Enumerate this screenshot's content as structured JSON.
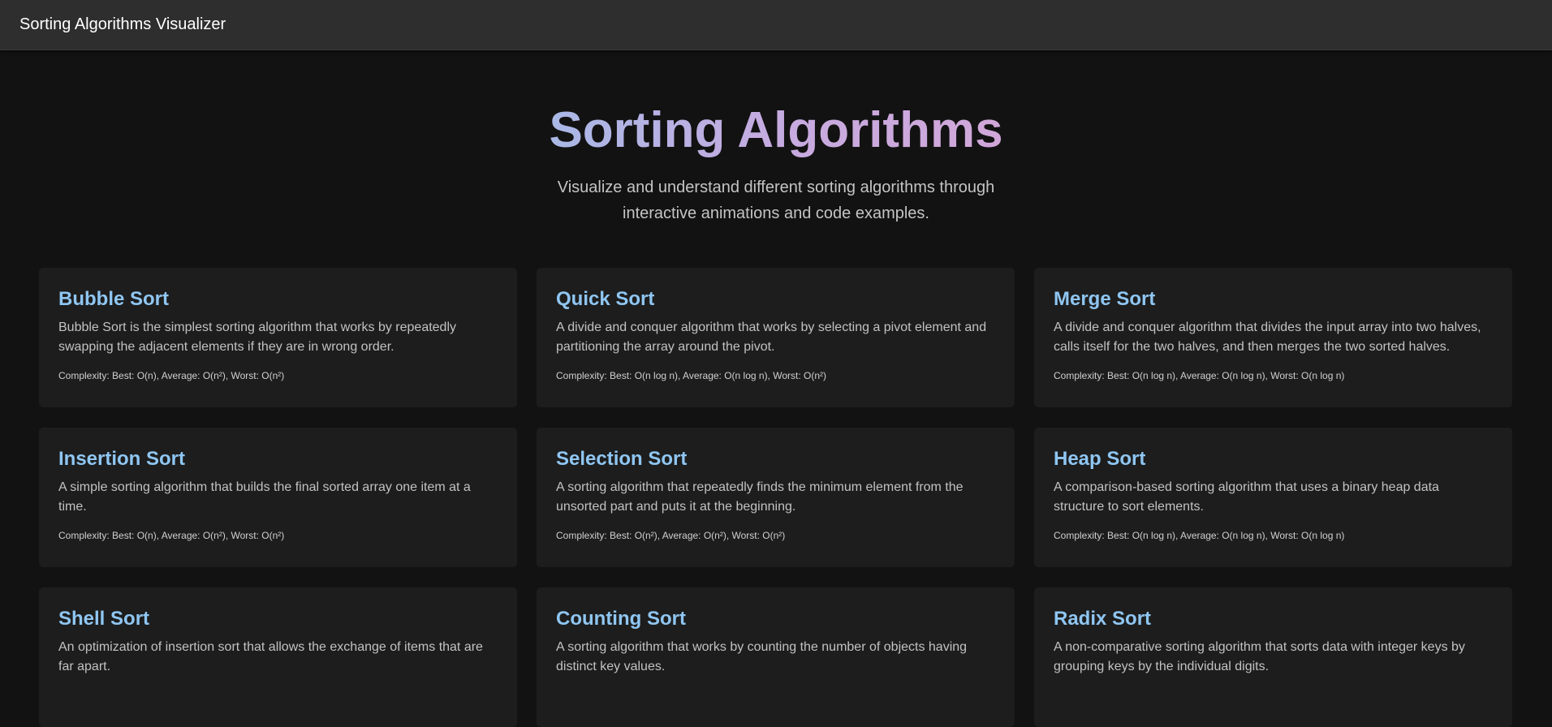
{
  "nav": {
    "brand": "Sorting Algorithms Visualizer"
  },
  "hero": {
    "title": "Sorting Algorithms",
    "subtitle": "Visualize and understand different sorting algorithms through interactive animations and code examples.",
    "title_gradient": [
      "#a9b8e6",
      "#d1a7d9"
    ]
  },
  "colors": {
    "background": "#121212",
    "navbar": "#2e2e2e",
    "card": "#1d1d1d",
    "card_title": "#8fc6f2"
  },
  "algorithms": [
    {
      "name": "Bubble Sort",
      "description": "Bubble Sort is the simplest sorting algorithm that works by repeatedly swapping the adjacent elements if they are in wrong order.",
      "complexity": "Complexity: Best: O(n), Average: O(n²), Worst: O(n²)"
    },
    {
      "name": "Quick Sort",
      "description": "A divide and conquer algorithm that works by selecting a pivot element and partitioning the array around the pivot.",
      "complexity": "Complexity: Best: O(n log n), Average: O(n log n), Worst: O(n²)"
    },
    {
      "name": "Merge Sort",
      "description": "A divide and conquer algorithm that divides the input array into two halves, calls itself for the two halves, and then merges the two sorted halves.",
      "complexity": "Complexity: Best: O(n log n), Average: O(n log n), Worst: O(n log n)"
    },
    {
      "name": "Insertion Sort",
      "description": "A simple sorting algorithm that builds the final sorted array one item at a time.",
      "complexity": "Complexity: Best: O(n), Average: O(n²), Worst: O(n²)"
    },
    {
      "name": "Selection Sort",
      "description": "A sorting algorithm that repeatedly finds the minimum element from the unsorted part and puts it at the beginning.",
      "complexity": "Complexity: Best: O(n²), Average: O(n²), Worst: O(n²)"
    },
    {
      "name": "Heap Sort",
      "description": "A comparison-based sorting algorithm that uses a binary heap data structure to sort elements.",
      "complexity": "Complexity: Best: O(n log n), Average: O(n log n), Worst: O(n log n)"
    },
    {
      "name": "Shell Sort",
      "description": "An optimization of insertion sort that allows the exchange of items that are far apart.",
      "complexity": ""
    },
    {
      "name": "Counting Sort",
      "description": "A sorting algorithm that works by counting the number of objects having distinct key values.",
      "complexity": ""
    },
    {
      "name": "Radix Sort",
      "description": "A non-comparative sorting algorithm that sorts data with integer keys by grouping keys by the individual digits.",
      "complexity": ""
    }
  ]
}
